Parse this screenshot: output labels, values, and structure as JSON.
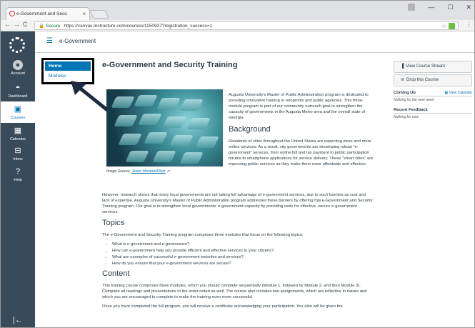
{
  "browser": {
    "tab_title": "e-Government and Secu",
    "tab_close": "×",
    "win_min": "—",
    "win_max": "☐",
    "win_close": "✕",
    "secure_label": "Secure",
    "url": "https://canvas.instructure.com/courses/1150937?registration_success=1"
  },
  "global_nav": {
    "account": "Account",
    "dashboard": "Dashboard",
    "courses": "Courses",
    "calendar": "Calendar",
    "inbox": "Inbox",
    "help": "Help"
  },
  "header": {
    "breadcrumb": "e-Government"
  },
  "course_nav": {
    "home": "Home",
    "modules": "Modules"
  },
  "page": {
    "title": "e-Government and Security Training",
    "intro": "Augusta University's Master of Public Administration program is dedicated to providing innovative training to nonprofits and public agencies. This three-module program is part of our community outreach goal to strengthen the capacity of governments in the Augusta Metro area and the overall state of Georgia.",
    "background_heading": "Background",
    "background_text": "Residents of cities throughout the United States are expecting more and more online services. As a result, city governments are developing robust \"e-government\" services, from online bill and tax payment to public participation forums to smartphone applications for service delivery. These \"smart cities\" are improving public services as they make them more affordable and effective.",
    "image_source_label": "Image Source: ",
    "image_source_link": "Javier Morales/Flickr",
    "research_text": "However, research shows that many local governments are not taking full advantage of e-government services, due to such barriers as cost and lack of expertise. Augusta University's Master of Public Administration program addresses these barriers by offering this e-Government and Security Training program. Our goal is to strengthen local governments' e-government capacity by providing tools for effective, secure e-government services.",
    "topics_heading": "Topics",
    "topics_intro": "The e-Government and Security Training program comprises three modules that focus on the following topics:",
    "topics": [
      "What is e-government and e-governance?",
      "How can e-government help you provide efficient and effective services to your citizens?",
      "What are examples of successful e-government websites and services?",
      "How do you ensure that your e-government services are secure?"
    ],
    "content_heading": "Content",
    "content_text": "This training course comprises three modules, which you should complete sequentially (Module 1, followed by Module 2, and then Module 3). Complete all readings and presentations in the order noted as well. The course also includes two assignments, which are reflective in nature and which you are encouraged to complete to make the training even more successful.",
    "completion_text": "Once you have completed the full program, you will receive a certificate acknowledging your participation. You also will be given the"
  },
  "sidebar": {
    "view_stream": "View Course Stream",
    "drop_course": "Drop this Course",
    "coming_up": "Coming Up",
    "view_calendar": "View Calendar",
    "coming_up_note": "Nothing for the next week",
    "recent_feedback": "Recent Feedback",
    "feedback_note": "Nothing for now"
  },
  "colors": {
    "nav_bg": "#394b58",
    "accent": "#0374b5"
  }
}
